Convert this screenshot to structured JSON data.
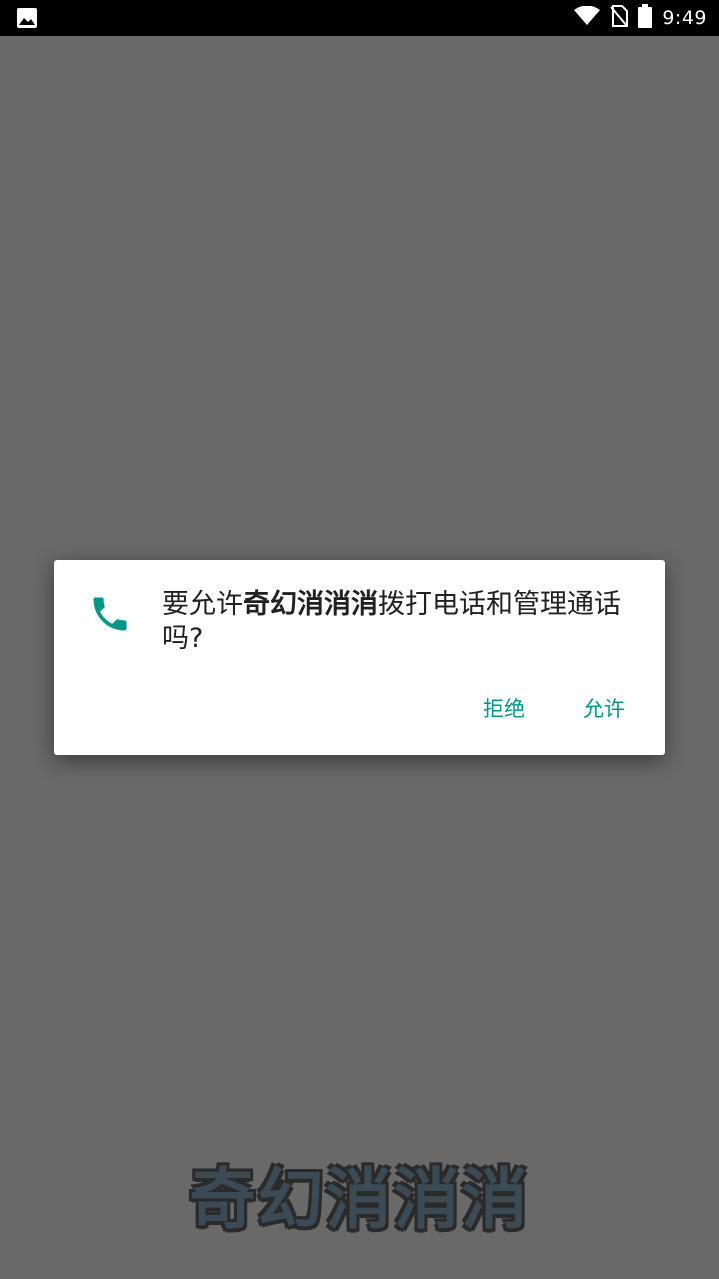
{
  "status_bar": {
    "time": "9:49",
    "icons": [
      "image-notification-icon",
      "wifi-icon",
      "no-sim-icon",
      "battery-icon"
    ]
  },
  "dialog": {
    "icon": "phone-icon",
    "message_prefix": "要允许",
    "app_name": "奇幻消消消",
    "message_suffix": "拨打电话和管理通话吗?",
    "deny_label": "拒绝",
    "allow_label": "允许"
  },
  "background": {
    "title": "奇幻消消消"
  },
  "colors": {
    "accent": "#009688",
    "scrim": "#696969",
    "status_bar": "#000000"
  }
}
